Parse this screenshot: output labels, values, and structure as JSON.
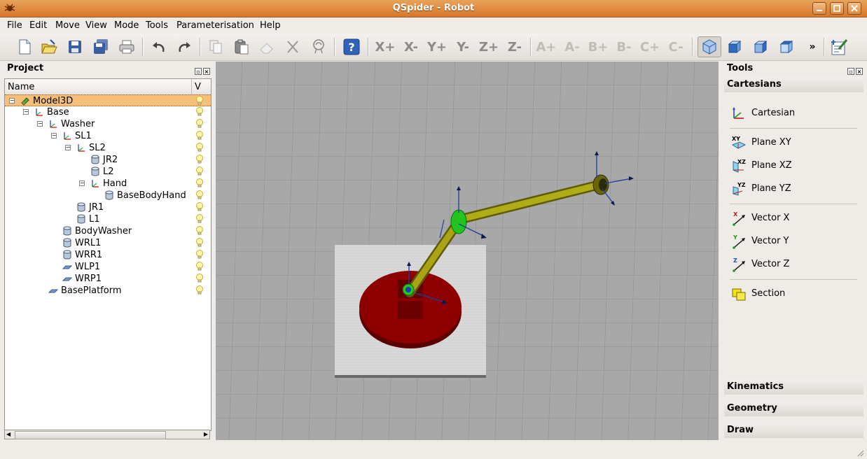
{
  "window": {
    "title": "QSpider - Robot",
    "icon": "app-icon",
    "controls": [
      "minimize-icon",
      "maximize-icon",
      "close-icon"
    ]
  },
  "menu": [
    "File",
    "Edit",
    "Move",
    "View",
    "Mode",
    "Tools",
    "Parameterisation",
    "Help"
  ],
  "toolbar": {
    "file_icons": [
      "new-file-icon",
      "open-file-icon",
      "save-icon",
      "save-all-icon",
      "print-icon"
    ],
    "edit_icons": [
      "undo-icon",
      "redo-icon",
      "copy-icon",
      "paste-icon",
      "eraser-icon",
      "cut-icon",
      "inspect-icon"
    ],
    "help_icon": "help-icon",
    "axis_buttons": [
      "X+",
      "X-",
      "Y+",
      "Y-",
      "Z+",
      "Z-",
      "A+",
      "A-",
      "B+",
      "B-",
      "C+",
      "C-"
    ],
    "view_icons": [
      "perspective-view-icon",
      "front-view-icon",
      "side-view-icon",
      "top-view-icon"
    ],
    "more": "»",
    "edit_mode_icon": "edit-mode-icon"
  },
  "project": {
    "title": "Project",
    "columns": [
      "Name",
      "V"
    ],
    "rows": [
      {
        "label": "Model3D",
        "icon": "model-icon"
      },
      {
        "label": "Base",
        "icon": "frame-icon"
      },
      {
        "label": "Washer",
        "icon": "frame-icon"
      },
      {
        "label": "SL1",
        "icon": "frame-icon"
      },
      {
        "label": "SL2",
        "icon": "frame-icon"
      },
      {
        "label": "JR2",
        "icon": "cylinder-icon"
      },
      {
        "label": "L2",
        "icon": "cylinder-icon"
      },
      {
        "label": "Hand",
        "icon": "frame-icon"
      },
      {
        "label": "BaseBodyHand",
        "icon": "cylinder-icon"
      },
      {
        "label": "JR1",
        "icon": "cylinder-icon"
      },
      {
        "label": "L1",
        "icon": "cylinder-icon"
      },
      {
        "label": "BodyWasher",
        "icon": "cylinder-icon"
      },
      {
        "label": "WRL1",
        "icon": "cylinder-icon"
      },
      {
        "label": "WRR1",
        "icon": "cylinder-icon"
      },
      {
        "label": "WLP1",
        "icon": "plate-icon"
      },
      {
        "label": "WRP1",
        "icon": "plate-icon"
      },
      {
        "label": "BasePlatform",
        "icon": "plate-icon"
      }
    ]
  },
  "tools": {
    "title": "Tools",
    "sections": {
      "cartesians": "Cartesians",
      "kinematics": "Kinematics",
      "geometry": "Geometry",
      "draw": "Draw"
    },
    "items": [
      {
        "label": "Cartesian",
        "icon": "cartesian-icon"
      },
      {
        "label": "Plane XY",
        "icon": "plane-xy-icon",
        "badge": "XY"
      },
      {
        "label": "Plane XZ",
        "icon": "plane-xz-icon",
        "badge": "XZ"
      },
      {
        "label": "Plane YZ",
        "icon": "plane-yz-icon",
        "badge": "YZ"
      },
      {
        "label": "Vector X",
        "icon": "vector-x-icon",
        "badge": "X"
      },
      {
        "label": "Vector Y",
        "icon": "vector-y-icon",
        "badge": "Y"
      },
      {
        "label": "Vector Z",
        "icon": "vector-z-icon",
        "badge": "Z"
      },
      {
        "label": "Section",
        "icon": "section-icon"
      }
    ]
  },
  "colors": {
    "titlebar": "#d9823a",
    "selection": "#f7c07a",
    "grid_background": "#a7a7a7",
    "disc": "#8e0000",
    "arm": "#9e9a12",
    "joint": "#22c41e"
  }
}
